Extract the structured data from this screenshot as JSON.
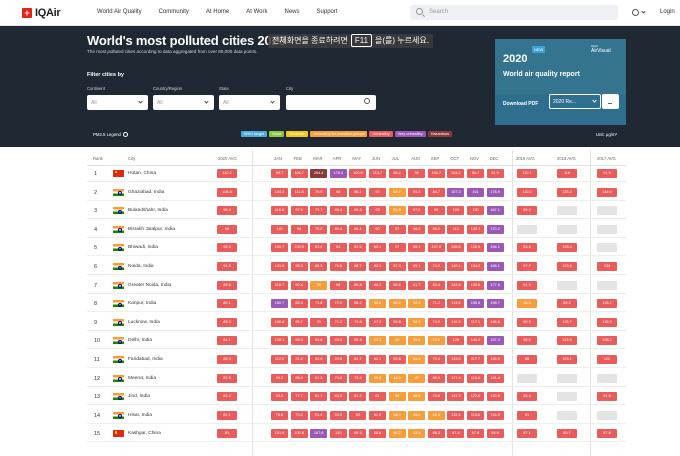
{
  "nav": {
    "logo_text": "IQAir",
    "items": [
      "World Air Quality",
      "Community",
      "At Home",
      "At Work",
      "News",
      "Support"
    ],
    "search_placeholder": "Search",
    "login": "Login"
  },
  "hero": {
    "title": "World's most polluted cities 2020",
    "subtitle": "The most polluted cities according to data aggregated from over 80,000 data points.",
    "overlay_text_before": "전체화면을 종료하려면",
    "overlay_key": "F11",
    "overlay_text_after": "을(를) 누르세요."
  },
  "filters": {
    "title": "Filter cities by",
    "continent_label": "Continent",
    "continent_value": "All",
    "country_label": "Country/Region",
    "country_value": "All",
    "state_label": "State",
    "state_value": "All",
    "city_label": "City"
  },
  "report": {
    "year": "2020",
    "new_badge": "NEW",
    "brand_line1": "IQAir",
    "brand_line2": "AirVisual",
    "title": "World air quality report",
    "download_label": "Download PDF",
    "select_value": "2020 Re..."
  },
  "legend": {
    "pm_label": "PM2.5 Legend",
    "unit": "Unit: μg/m³",
    "chips": [
      {
        "label": "WHO target",
        "color": "#4ea8de"
      },
      {
        "label": "Good",
        "color": "#8cc63f"
      },
      {
        "label": "Moderate",
        "color": "#f5c518"
      },
      {
        "label": "Unhealthy for sensitive groups",
        "color": "#f59e3b"
      },
      {
        "label": "Unhealthy",
        "color": "#e85c5c"
      },
      {
        "label": "Very unhealthy",
        "color": "#9b59b6"
      },
      {
        "label": "Hazardous",
        "color": "#8b3a3a"
      }
    ]
  },
  "table": {
    "headers": {
      "rank": "Rank",
      "city": "City",
      "avg2020": "2020 AVG",
      "months": [
        "JAN",
        "FEB",
        "MAR",
        "APR",
        "MAY",
        "JUN",
        "JUL",
        "AUG",
        "SEP",
        "OCT",
        "NOV",
        "DEC"
      ],
      "avg2019": "2019 AVG",
      "avg2018": "2018 AVG",
      "avg2017": "2017 AVG"
    },
    "rows": [
      {
        "rank": "1",
        "country": "cn",
        "city": "Hotan, China",
        "avg2020": "110.2",
        "months": [
          "93.7",
          "104.7",
          "264.4",
          "176.4",
          "100.9",
          "113.7",
          "85.2",
          "56",
          "100.7",
          "104.2",
          "84.7",
          "81.9"
        ],
        "avg2019": "110.1",
        "avg2018": "116",
        "avg2017": "91.9"
      },
      {
        "rank": "2",
        "country": "in",
        "city": "Ghaziabad, India",
        "avg2020": "106.6",
        "months": [
          "144.3",
          "111.8",
          "79.9",
          "68",
          "86.1",
          "60",
          "53.7",
          "59.3",
          "84.7",
          "157.3",
          "161",
          "178.9"
        ],
        "avg2019": "110.2",
        "avg2018": "135.2",
        "avg2017": "144.6"
      },
      {
        "rank": "3",
        "country": "in",
        "city": "Bulandshahr, India",
        "avg2020": "98.4",
        "months": [
          "116.8",
          "97.6",
          "71.7",
          "86.4",
          "86.3",
          "63",
          "54.9",
          "57.2",
          "65",
          "105",
          "130",
          "167.1"
        ],
        "avg2019": "89.4",
        "avg2018": "",
        "avg2017": ""
      },
      {
        "rank": "4",
        "country": "in",
        "city": "Bisrakh Jalalpur, India",
        "avg2020": "96",
        "months": [
          "140",
          "98",
          "70.2",
          "80.4",
          "85.1",
          "60",
          "57",
          "56.2",
          "59.2",
          "113",
          "133.7",
          "170.2"
        ],
        "avg2019": "",
        "avg2018": "",
        "avg2017": ""
      },
      {
        "rank": "5",
        "country": "in",
        "city": "Bhiwadi, India",
        "avg2020": "95.5",
        "months": [
          "100.7",
          "103.9",
          "81.4",
          "84",
          "83.9",
          "60.1",
          "57",
          "59.1",
          "107.8",
          "126.6",
          "128.5",
          "154.1"
        ],
        "avg2019": "83.4",
        "avg2018": "125.4",
        "avg2017": ""
      },
      {
        "rank": "6",
        "country": "in",
        "city": "Noida, India",
        "avg2020": "94.3",
        "months": [
          "131.6",
          "98.3",
          "65.3",
          "76.6",
          "88.7",
          "62.3",
          "57.3",
          "69.1",
          "74.5",
          "146.1",
          "134.2",
          "168.1"
        ],
        "avg2019": "97.7",
        "avg2018": "123.6",
        "avg2017": "134"
      },
      {
        "rank": "7",
        "country": "in",
        "city": "Greater Noida, India",
        "avg2020": "89.5",
        "months": [
          "116.7",
          "90.4",
          "55",
          "68",
          "88.8",
          "64.1",
          "55.6",
          "61.7",
          "63.4",
          "124.6",
          "130.6",
          "177.8"
        ],
        "avg2019": "91.3",
        "avg2018": "",
        "avg2017": ""
      },
      {
        "rank": "8",
        "country": "in",
        "city": "Kanpur, India",
        "avg2020": "89.1",
        "months": [
          "150.7",
          "83.9",
          "71.8",
          "72.3",
          "89.2",
          "54.6",
          "53.2",
          "52.4",
          "71.2",
          "114.6",
          "155.6",
          "158.7"
        ],
        "avg2019": "48.3",
        "avg2018": "89.2",
        "avg2017": "115.2"
      },
      {
        "rank": "9",
        "country": "in",
        "city": "Lucknow, India",
        "avg2020": "88.2",
        "months": [
          "106.8",
          "95.7",
          "70",
          "71.2",
          "74.8",
          "57.3",
          "55.8",
          "52.3",
          "74.9",
          "116.3",
          "117.1",
          "146.6"
        ],
        "avg2019": "90.3",
        "avg2018": "115.7",
        "avg2017": "115.3"
      },
      {
        "rank": "10",
        "country": "in",
        "city": "Delhi, India",
        "avg2020": "84.1",
        "months": [
          "128.1",
          "99.6",
          "64.8",
          "63.5",
          "85.3",
          "52.3",
          "40",
          "36.8",
          "53.9",
          "128",
          "140.2",
          "157.3"
        ],
        "avg2019": "98.6",
        "avg2018": "113.5",
        "avg2017": "108.2"
      },
      {
        "rank": "11",
        "country": "in",
        "city": "Faridabad, India",
        "avg2020": "83.3",
        "months": [
          "112.2",
          "91.2",
          "64.9",
          "69.6",
          "84.7",
          "61.1",
          "55.8",
          "54.4",
          "70.4",
          "133.9",
          "117.7",
          "115.9"
        ],
        "avg2019": "85",
        "avg2018": "129.1",
        "avg2017": "122"
      },
      {
        "rank": "12",
        "country": "in",
        "city": "Meerut, India",
        "avg2020": "82.9",
        "months": [
          "99.2",
          "85.8",
          "61.3",
          "74.8",
          "73.9",
          "49.8",
          "44.2",
          "47",
          "89.5",
          "127.4",
          "115.6",
          "141.4"
        ],
        "avg2019": "",
        "avg2018": "",
        "avg2017": ""
      },
      {
        "rank": "13",
        "country": "in",
        "city": "Jind, India",
        "avg2020": "82.4",
        "months": [
          "93.2",
          "77.7",
          "61.7",
          "84.2",
          "81.2",
          "61",
          "38",
          "48.6",
          "70.8",
          "141.3",
          "122.6",
          "110.6"
        ],
        "avg2019": "85.4",
        "avg2018": "",
        "avg2017": "91.6"
      },
      {
        "rank": "14",
        "country": "in",
        "city": "Hisar, India",
        "avg2020": "81.1",
        "months": [
          "78.6",
          "73.3",
          "61.4",
          "93.9",
          "93",
          "61.9",
          "54.3",
          "45.8",
          "45.3",
          "132.4",
          "115.6",
          "116.3"
        ],
        "avg2019": "91",
        "avg2018": "",
        "avg2017": ""
      },
      {
        "rank": "15",
        "country": "cn",
        "city": "Kashgar, China",
        "avg2020": "81",
        "months": [
          "101.9",
          "109.8",
          "167.8",
          "120",
          "69.3",
          "58.6",
          "49.2",
          "43.9",
          "66.3",
          "67.4",
          "67.5",
          "84.9"
        ],
        "avg2019": "87.1",
        "avg2018": "90.7",
        "avg2017": "87.8"
      }
    ]
  }
}
